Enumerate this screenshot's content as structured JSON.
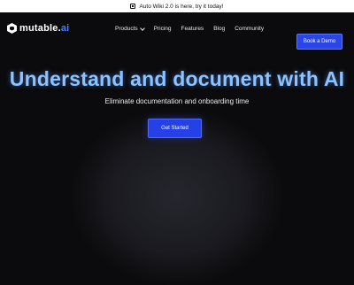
{
  "announcement": {
    "icon": "wiki-icon",
    "text": "Auto Wiki 2.0 is here, try it today!"
  },
  "logo": {
    "name_part1": "mutable",
    "separator": ".",
    "name_part2": "ai"
  },
  "nav": [
    {
      "label": "Products",
      "has_dropdown": true
    },
    {
      "label": "Pricing"
    },
    {
      "label": "Features"
    },
    {
      "label": "Blog"
    },
    {
      "label": "Community"
    }
  ],
  "header": {
    "demo_label": "Book a Demo"
  },
  "hero": {
    "headline": "Understand and document with AI",
    "subheadline": "Eliminate documentation and onboarding time",
    "cta_label": "Get Started"
  },
  "colors": {
    "accent": "#2b46e8",
    "headline": "#8ec2ff",
    "logo_ai": "#4c7dff",
    "background": "#0b0b0d"
  }
}
